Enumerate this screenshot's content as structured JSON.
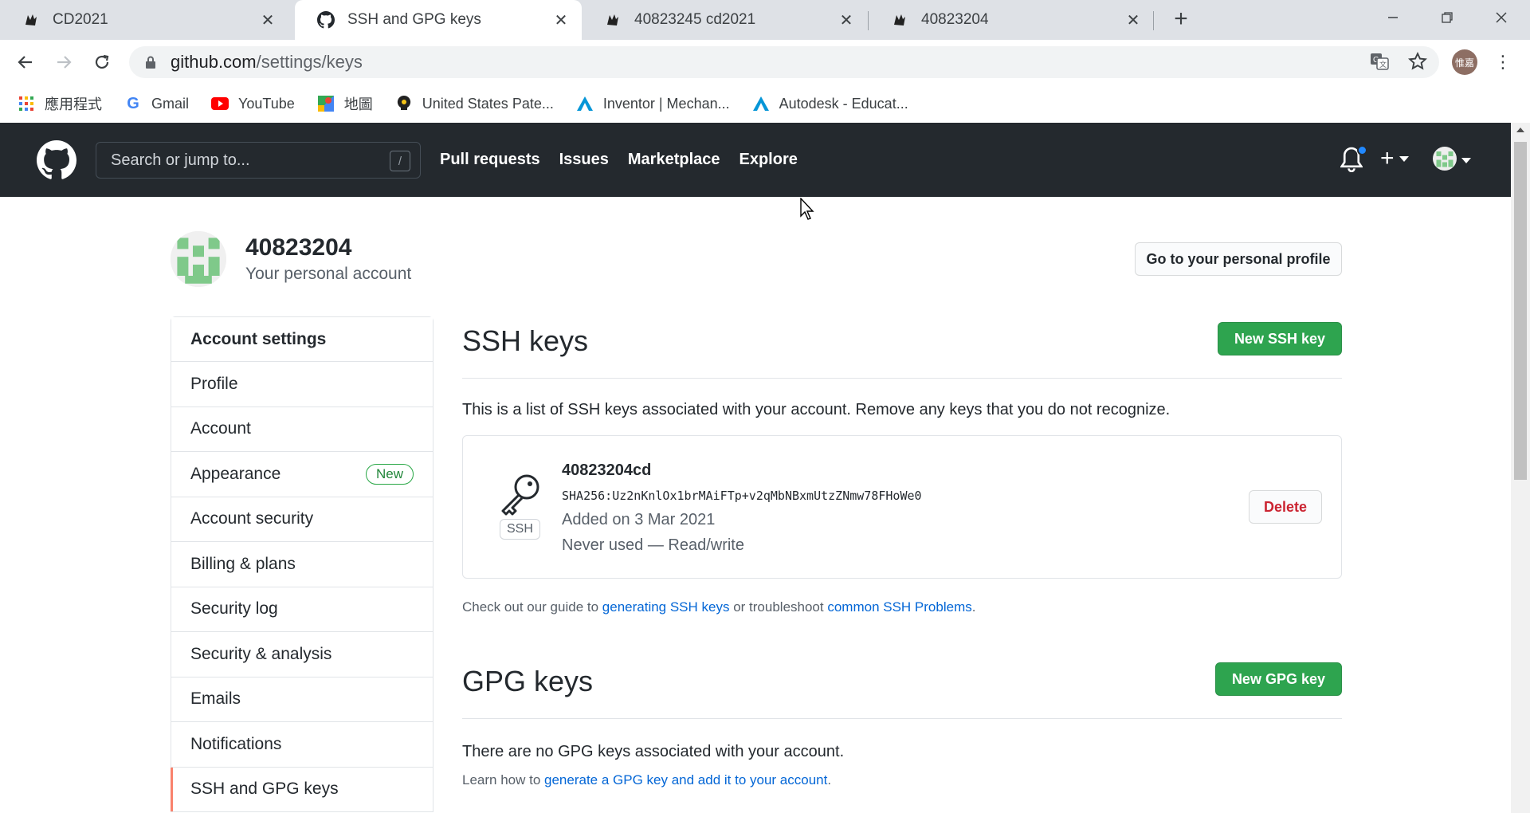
{
  "browser": {
    "tabs": [
      {
        "title": "CD2021",
        "icon": "cd-favicon"
      },
      {
        "title": "SSH and GPG keys",
        "icon": "github-favicon",
        "active": true
      },
      {
        "title": "40823245 cd2021",
        "icon": "cd-favicon"
      },
      {
        "title": "40823204",
        "icon": "cd-favicon"
      }
    ],
    "address": {
      "host": "github.com",
      "path": "/settings/keys"
    },
    "profile_initials": "惟嘉",
    "bookmarks": [
      {
        "label": "應用程式",
        "icon": "apps-grid-icon"
      },
      {
        "label": "Gmail",
        "icon": "google-icon"
      },
      {
        "label": "YouTube",
        "icon": "youtube-icon"
      },
      {
        "label": "地圖",
        "icon": "maps-icon"
      },
      {
        "label": "United States Pate...",
        "icon": "patent-icon"
      },
      {
        "label": "Inventor | Mechan...",
        "icon": "autodesk-icon"
      },
      {
        "label": "Autodesk - Educat...",
        "icon": "autodesk-icon"
      }
    ]
  },
  "github": {
    "search_placeholder": "Search or jump to...",
    "search_shortcut": "/",
    "nav": [
      "Pull requests",
      "Issues",
      "Marketplace",
      "Explore"
    ],
    "plus_label": "+",
    "account": {
      "name": "40823204",
      "subtitle": "Your personal account",
      "profile_button": "Go to your personal profile"
    },
    "sidebar": {
      "header": "Account settings",
      "items": [
        {
          "label": "Profile"
        },
        {
          "label": "Account"
        },
        {
          "label": "Appearance",
          "badge": "New"
        },
        {
          "label": "Account security"
        },
        {
          "label": "Billing & plans"
        },
        {
          "label": "Security log"
        },
        {
          "label": "Security & analysis"
        },
        {
          "label": "Emails"
        },
        {
          "label": "Notifications"
        },
        {
          "label": "SSH and GPG keys",
          "selected": true
        }
      ]
    },
    "ssh": {
      "title": "SSH keys",
      "new_button": "New SSH key",
      "description": "This is a list of SSH keys associated with your account. Remove any keys that you do not recognize.",
      "key": {
        "title": "40823204cd",
        "type_label": "SSH",
        "fingerprint": "SHA256:Uz2nKnlOx1brMAiFTp+v2qMbNBxmUtzZNmw78FHoWe0",
        "added": "Added on 3 Mar 2021",
        "usage": "Never used — Read/write",
        "delete_button": "Delete"
      },
      "guide": {
        "prefix": "Check out our guide to ",
        "link1": "generating SSH keys",
        "middle": " or troubleshoot ",
        "link2": "common SSH Problems",
        "suffix": "."
      }
    },
    "gpg": {
      "title": "GPG keys",
      "new_button": "New GPG key",
      "empty_text": "There are no GPG keys associated with your account.",
      "learn": {
        "prefix": "Learn how to ",
        "link": "generate a GPG key and add it to your account",
        "suffix": "."
      }
    }
  },
  "colors": {
    "header_bg": "#24292e",
    "primary_green": "#2ea44f",
    "link_blue": "#0366d6",
    "danger_red": "#cb2431",
    "selected_accent": "#f9826c"
  }
}
